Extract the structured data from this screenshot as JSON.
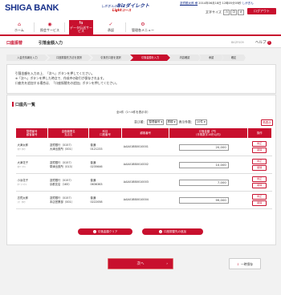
{
  "header": {
    "logo": "SHIGA BANK",
    "service_prefix": "しがぎんの",
    "service_name": "Bizダイレクト",
    "service_sub": "Lightコース",
    "user_label": "滋賀銀太郎 様",
    "login_info": "2014年06月18日 12時05分05秒",
    "user_id": "しがぎん",
    "font_size_label": "文字サイズ",
    "font_small": "小",
    "font_medium": "中",
    "font_large": "大",
    "logout_label": "ログアウト"
  },
  "nav": {
    "items": [
      {
        "label": "ホーム",
        "icon": "home-icon",
        "glyph": "⌂"
      },
      {
        "label": "照会サービス",
        "icon": "search-icon",
        "glyph": "🔍"
      },
      {
        "label": "データ伝送サービス",
        "icon": "transfer-icon",
        "glyph": "⇆"
      },
      {
        "label": "承認",
        "icon": "approval-icon",
        "glyph": "✓"
      },
      {
        "label": "管理各メニュー",
        "icon": "gear-icon",
        "glyph": "⚙"
      }
    ]
  },
  "titlebar": {
    "category": "口座振替",
    "title": "引落金額入力",
    "code": "BKZF009",
    "help": "ヘルプ",
    "help_q": "?"
  },
  "steps": [
    {
      "label": "入金先情報を入力"
    },
    {
      "label": "口座振替先方法を選択"
    },
    {
      "label": "引落先口座を選択"
    },
    {
      "label": "引落金額を入力"
    },
    {
      "label": "内容確認"
    },
    {
      "label": "承認"
    },
    {
      "label": "確定"
    }
  ],
  "messages": [
    "引落金額を入力の上、「次へ」ボタンを押してください。",
    "※「次へ」ボタンを押した時点で、作成中の取引が保存されます。",
    "口座先を追加する場合は、「口座振替先の追加」ボタンを押してください。"
  ],
  "list": {
    "title": "口座先一覧",
    "count": "全4件（1〜4件を表示中）",
    "sort_label": "並び順：",
    "sort_value": "整理番号",
    "order_value": "昇順",
    "per_page_label": "表示件数：",
    "per_page_value": "10件",
    "redisplay": "再表示",
    "columns": [
      "整理番号\n顧客番号",
      "金融機関名\n支店名",
      "科目\n口座番号",
      "顧客番号",
      "引落金額（円）\n（半角数字10桁以内）",
      "操作"
    ],
    "modify_label": "修正",
    "delete_label": "削除",
    "rows": [
      {
        "name": "大津太郎",
        "kana": "ｵｵﾂ ﾀﾛｳ",
        "bank": "滋賀銀行（0157）",
        "branch": "大津出張所（001）",
        "type": "普通",
        "acct": "0121233",
        "cust": "AAA01BB0010001",
        "amount": "20,000"
      },
      {
        "name": "大津花子",
        "kana": "ｵｵﾂ ﾊﾅｺ",
        "bank": "滋賀銀行（0157）",
        "branch": "草津出張所（013）",
        "type": "普通",
        "acct": "0235646",
        "cust": "AAA01BB0010002",
        "amount": "10,000"
      },
      {
        "name": "小浜花子",
        "kana": "ｵﾊﾞﾏ ﾊﾅｺ",
        "bank": "滋賀銀行（0157）",
        "branch": "京都支店（183）",
        "type": "普通",
        "acct": "0636363",
        "cust": "AAA01BB0010003",
        "amount": "7,000"
      },
      {
        "name": "志賀太郎",
        "kana": "ｼｶﾞ ﾀﾛｳ",
        "bank": "滋賀銀行（0157）",
        "branch": "本店営業部（001）",
        "type": "普通",
        "acct": "0222058",
        "cust": "AAA01BB0010004",
        "amount": "99,000"
      }
    ],
    "clear_button": "引落金額クリア",
    "add_button": "口座振替先の追加"
  },
  "footer": {
    "next_button": "次へ",
    "save_button": "一時保存"
  },
  "colors": {
    "accent": "#c8102e",
    "brand": "#17308a"
  }
}
